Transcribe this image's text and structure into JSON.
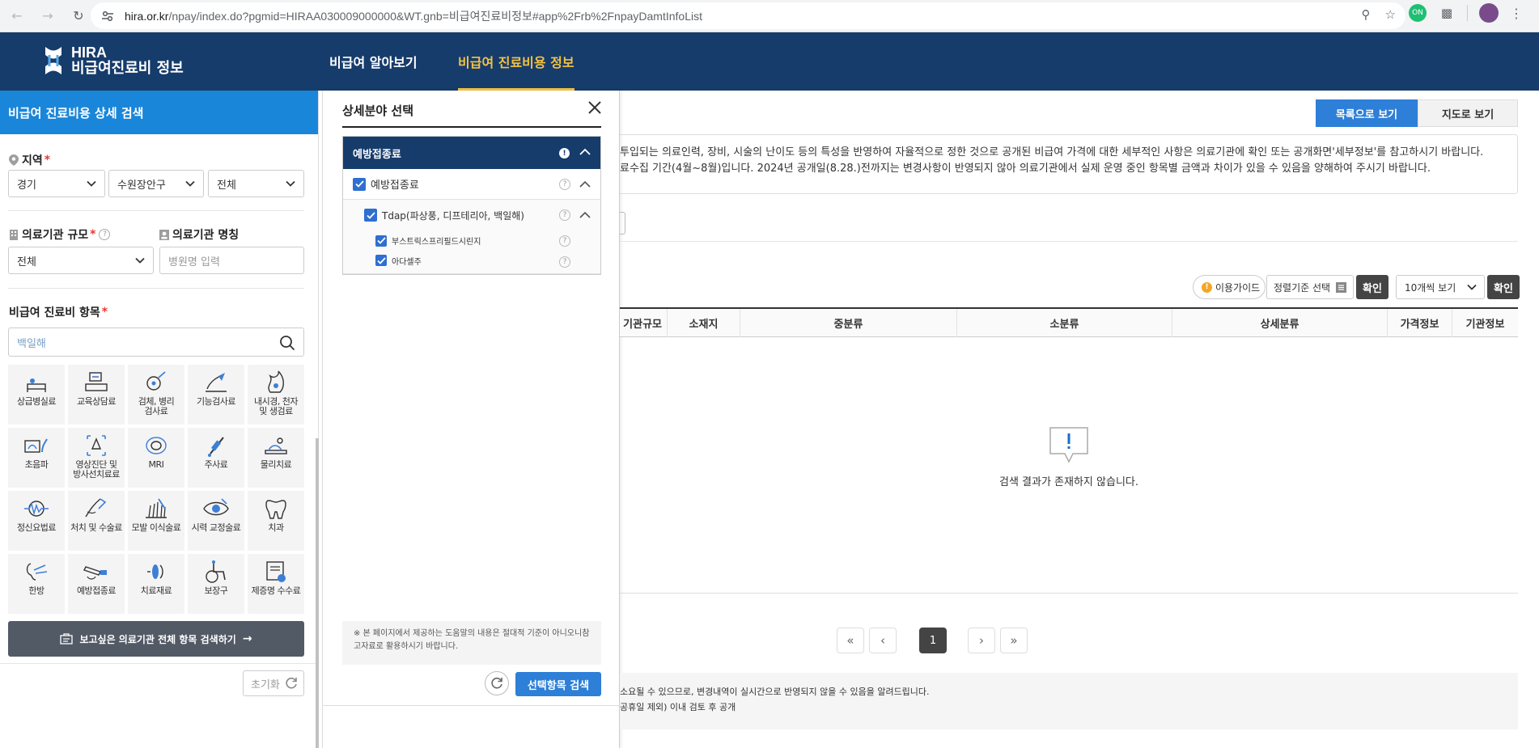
{
  "browser": {
    "url_host": "hira.or.kr",
    "url_path": "/npay/index.do?pgmid=HIRAA030009000000&WT.gnb=비급여진료비정보#app%2Frb%2FnpayDamtInfoList",
    "ext_badge": "ON"
  },
  "header": {
    "logo_line1": "HIRA",
    "logo_line2": "비급여진료비 정보",
    "nav": [
      {
        "label": "비급여 알아보기"
      },
      {
        "label": "비급여 진료비용 정보"
      }
    ]
  },
  "search_panel": {
    "title": "비급여 진료비용 상세 검색",
    "region_label": "지역",
    "required_mark": "*",
    "region_selects": [
      "경기",
      "수원장안구",
      "전체"
    ],
    "scale_label": "의료기관 규모",
    "scale_value": "전체",
    "name_label": "의료기관 명칭",
    "name_placeholder": "병원명 입력",
    "items_label": "비급여 진료비 항목",
    "items_search_value": "백일해",
    "categories": [
      {
        "label": "상급병실료"
      },
      {
        "label": "교육상담료"
      },
      {
        "label": "검체, 병리\n검사료"
      },
      {
        "label": "기능검사료"
      },
      {
        "label": "내시경, 천자\n및 생검료"
      },
      {
        "label": "초음파"
      },
      {
        "label": "영상진단 및\n방사선치료료"
      },
      {
        "label": "MRI"
      },
      {
        "label": "주사료"
      },
      {
        "label": "물리치료"
      },
      {
        "label": "정신요법료"
      },
      {
        "label": "처치 및 수술료"
      },
      {
        "label": "모발 이식술료"
      },
      {
        "label": "시력 교정술료"
      },
      {
        "label": "치과"
      },
      {
        "label": "한방"
      },
      {
        "label": "예방접종료"
      },
      {
        "label": "치료재료"
      },
      {
        "label": "보장구"
      },
      {
        "label": "제증명 수수료"
      }
    ],
    "all_search_label": "보고싶은 의료기관 전체 항목 검색하기",
    "reset_label": "초기화"
  },
  "detail_modal": {
    "title": "상세분야 선택",
    "group_header": "예방접종료",
    "rows": [
      {
        "label": "예방접종료"
      },
      {
        "label": "Tdap(파상풍, 디프테리아, 백일해)"
      },
      {
        "label": "부스트릭스프리필드시린지"
      },
      {
        "label": "아다셀주"
      }
    ],
    "note": "※ 본 페이지에서 제공하는 도움말의 내용은 절대적 기준이 아니오니참고자료로 활용하시기 바랍니다.",
    "search_button": "선택항목 검색"
  },
  "main": {
    "view_list": "목록으로 보기",
    "view_map": "지도로 보기",
    "notice_line1": "투입되는 의료인력, 장비, 시술의 난이도 등의 특성을 반영하여 자율적으로 정한 것으로 공개된 비급여 가격에 대한 세부적인 사항은 의료기관에 확인 또는 공개화면'세부정보'를 참고하시기 바랍니다.",
    "notice_line2": "료수집 기간(4월~8월)입니다. 2024년 공개일(8.28.)전까지는 변경사항이 반영되지 않아 의료기관에서 실제 운영 중인 항목별 금액과 차이가 있을 수 있음을 양해하여 주시기 바랍니다.",
    "guide_label": "이용가이드",
    "sort_label": "정렬기준 선택",
    "confirm_label": "확인",
    "per_page": "10개씩 보기",
    "columns": [
      "기관규모",
      "소재지",
      "중분류",
      "소분류",
      "상세분류",
      "가격정보",
      "기관정보"
    ],
    "empty_message": "검색 결과가 존재하지 않습니다.",
    "current_page": "1",
    "footnote_line1": "소요될 수 있으므로, 변경내역이 실시간으로 반영되지 않을 수 있음을 알려드립니다.",
    "footnote_line2": "공휴일 제외) 이내 검토 후 공개"
  },
  "colors": {
    "header_bg": "#163c6b",
    "panel_head": "#1a86d9",
    "accent_yellow": "#f5c242",
    "primary_blue": "#2d7fd8"
  }
}
